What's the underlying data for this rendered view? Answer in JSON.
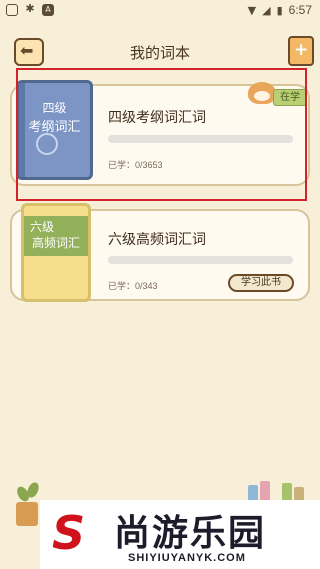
{
  "status_bar": {
    "time": "6:57",
    "left_icons": [
      "android-icon",
      "bug-icon",
      "a-icon"
    ],
    "right_icons": [
      "wifi-icon",
      "signal-icon",
      "battery-icon"
    ]
  },
  "header": {
    "title": "我的词本",
    "back_icon": "back-arrow-icon",
    "add_icon": "add-book-icon"
  },
  "books": [
    {
      "cover_line1": "四级",
      "cover_line2": "考纲词汇",
      "title": "四级考纲词汇词",
      "learned": "已学：0/3653",
      "progress": 0,
      "tag": "在学",
      "cover_color": "#7c95c4"
    },
    {
      "cover_line1": "六级",
      "cover_line2": "高频词汇",
      "title": "六级高频词汇词",
      "learned": "已学：0/343",
      "progress": 0,
      "button": "学习此书",
      "cover_color": "#f5df8d"
    }
  ],
  "watermark": {
    "mark": "S",
    "brand": "尚游乐园",
    "url": "SHIYIUYANYK.COM"
  },
  "colors": {
    "background": "#f8efd9",
    "highlight": "#d3232a",
    "card_border": "#d9c39a"
  }
}
